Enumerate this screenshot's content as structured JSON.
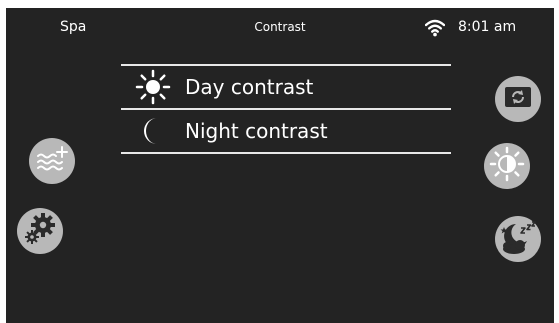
{
  "status": {
    "app_name": "Spa",
    "title": "Contrast",
    "time": "8:01 am",
    "wifi_icon": "wifi-icon"
  },
  "menu": {
    "items": [
      {
        "label": "Day contrast",
        "icon": "sun-icon"
      },
      {
        "label": "Night contrast",
        "icon": "moon-icon"
      }
    ]
  },
  "left_buttons": [
    {
      "icon": "water-temp-icon"
    },
    {
      "icon": "settings-gears-icon"
    }
  ],
  "right_buttons": [
    {
      "icon": "refresh-icon"
    },
    {
      "icon": "brightness-icon"
    },
    {
      "icon": "sleep-mode-icon"
    }
  ],
  "colors": {
    "background": "#232323",
    "button": "#b8b8b8",
    "icon_dark": "#2b2b2b",
    "text": "#ffffff"
  }
}
